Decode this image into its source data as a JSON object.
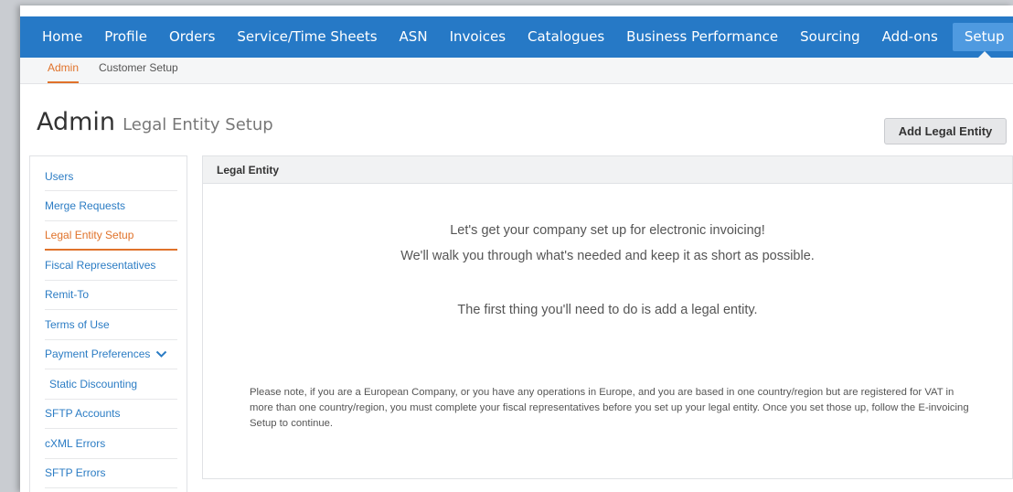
{
  "topnav": {
    "items": [
      "Home",
      "Profile",
      "Orders",
      "Service/Time Sheets",
      "ASN",
      "Invoices",
      "Catalogues",
      "Business Performance",
      "Sourcing",
      "Add-ons"
    ],
    "active": "Setup"
  },
  "subnav": {
    "active": "Admin",
    "other": "Customer Setup"
  },
  "page": {
    "title": "Admin",
    "subtitle": "Legal Entity Setup",
    "add_button": "Add Legal Entity"
  },
  "sidebar": {
    "items": [
      "Users",
      "Merge Requests",
      "Legal Entity Setup",
      "Fiscal Representatives",
      "Remit-To",
      "Terms of Use",
      "Payment Preferences",
      "Static Discounting",
      "SFTP Accounts",
      "cXML Errors",
      "SFTP Errors"
    ]
  },
  "panel": {
    "header": "Legal Entity",
    "line1": "Let's get your company set up for electronic invoicing!",
    "line2": "We'll walk you through what's needed and keep it as short as possible.",
    "line3": "The first thing you'll need to do is add a legal entity.",
    "note": "Please note, if you are a European Company, or you have any operations in Europe, and you are based in one country/region but are registered for VAT in more than one country/region, you must complete your fiscal representatives before you set up your legal entity. Once you set those up, follow the E-invoicing Setup to continue."
  },
  "colors": {
    "nav_bg": "#2679c6",
    "active_tab": "#4f9ae0",
    "accent": "#e0722a",
    "link": "#2b7cc4"
  }
}
